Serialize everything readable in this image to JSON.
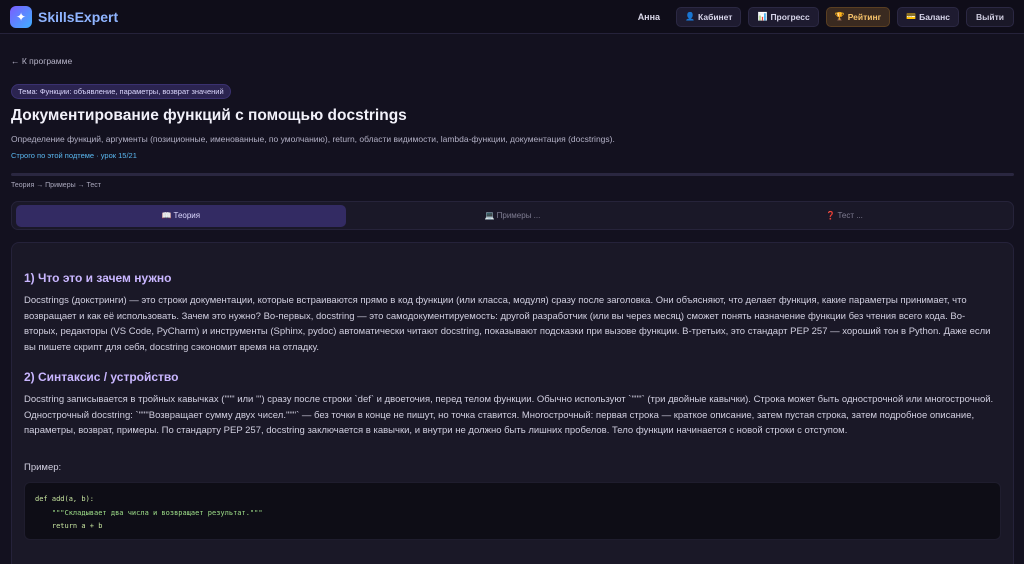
{
  "header": {
    "logo_glyph": "✦",
    "app_name": "SkillsExpert",
    "user_name": "Анна",
    "nav": [
      {
        "icon": "user-icon",
        "glyph": "👤",
        "label": "Кабинет"
      },
      {
        "icon": "chart-icon",
        "glyph": "📊",
        "label": "Прогресс"
      },
      {
        "icon": "trophy-icon",
        "glyph": "🏆",
        "label": "Рейтинг"
      },
      {
        "icon": "card-icon",
        "glyph": "💳",
        "label": "Баланс"
      }
    ],
    "logout_label": "Выйти"
  },
  "main": {
    "back_link": "← К программе",
    "topic_badge": "Тема: Функции: объявление, параметры, возврат значений",
    "title": "Документирование функций с помощью docstrings",
    "description": "Определение функций, аргументы (позиционные, именованные, по умолчанию), return, области видимости, lambda-функции, документация (docstrings).",
    "lesson_meta": "Строго по этой подтеме · урок 15/21",
    "steps": "Теория → Примеры → Тест",
    "tabs": [
      {
        "glyph": "📖",
        "label": "Теория",
        "active": true
      },
      {
        "glyph": "💻",
        "label": "Примеры ...",
        "active": false
      },
      {
        "glyph": "❓",
        "label": "Тест ...",
        "active": false
      }
    ]
  },
  "content": {
    "section1_title": "1) Что это и зачем нужно",
    "section1_text": "Docstrings (докстринги) — это строки документации, которые встраиваются прямо в код функции (или класса, модуля) сразу после заголовка. Они объясняют, что делает функция, какие параметры принимает, что возвращает и как её использовать. Зачем это нужно? Во-первых, docstring — это самодокументируемость: другой разработчик (или вы через месяц) сможет понять назначение функции без чтения всего кода. Во-вторых, редакторы (VS Code, PyCharm) и инструменты (Sphinx, pydoc) автоматически читают docstring, показывают подсказки при вызове функции. В-третьих, это стандарт PEP 257 — хороший тон в Python. Даже если вы пишете скрипт для себя, docstring сэкономит время на отладку.",
    "section2_title": "2) Синтаксис / устройство",
    "section2_text": "Docstring записывается в тройных кавычках (\"\"\" или ''') сразу после строки `def` и двоеточия, перед телом функции. Обычно используют `\"\"\"` (три двойные кавычки). Строка может быть однострочной или многострочной. Однострочный docstring: `\"\"\"Возвращает сумму двух чисел.\"\"\"` — без точки в конце не пишут, но точка ставится. Многострочный: первая строка — краткое описание, затем пустая строка, затем подробное описание, параметры, возврат, примеры. По стандарту PEP 257, docstring заключается в кавычки, и внутри не должно быть лишних пробелов. Тело функции начинается с новой строки с отступом.",
    "example_label": "Пример:",
    "code_lines": [
      "def add(a, b):",
      "    \"\"\"Складывает два числа и возвращает результат.\"\"\"",
      "    return a + b"
    ]
  }
}
